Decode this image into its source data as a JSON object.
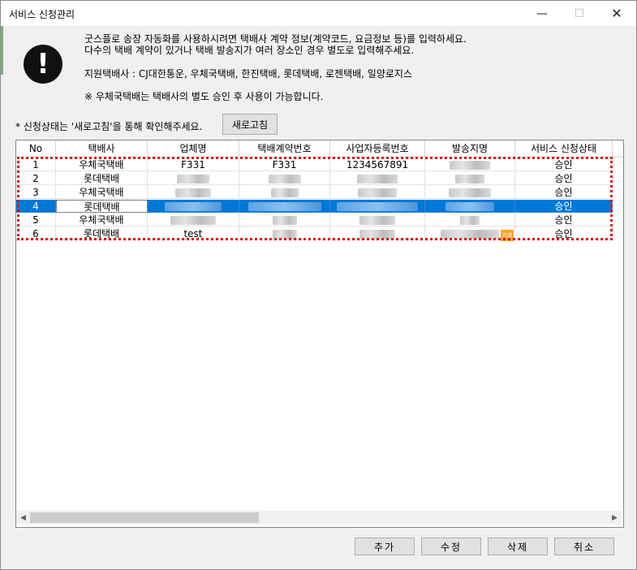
{
  "window": {
    "title": "서비스 신청관리",
    "minimize": "—",
    "maximize": "☐",
    "close": "✕"
  },
  "info": {
    "icon": "exclamation-icon",
    "icon_glyph": "!",
    "line1": "굿스플로 송장 자동화를 사용하시려면 택배사 계약 정보(계약코드, 요금정보 등)를 입력하세요.",
    "line2": "다수의 택배 계약이 있거나 택배 발송지가 여러 장소인 경우 별도로 입력해주세요.",
    "line3": "지원택배사 : CJ대한통운, 우체국택배, 한진택배, 롯데택배, 로젠택배, 일양로지스",
    "line4": "※ 우체국택배는 택배사의 별도 승인 후 사용이 가능합니다."
  },
  "status_hint": "* 신청상태는 '새로고침'을 통해 확인해주세요.",
  "refresh_label": "새로고침",
  "table": {
    "columns": [
      "No",
      "택배사",
      "업체명",
      "택배계약번호",
      "사업자등록번호",
      "발송지명",
      "서비스 신청상태"
    ],
    "rows": [
      {
        "no": "1",
        "carrier": "우체국택배",
        "company": "F331",
        "contract": "F331",
        "bizno": "1234567891",
        "sender": "",
        "status": "승인"
      },
      {
        "no": "2",
        "carrier": "롯데택배",
        "company": "",
        "contract": "",
        "bizno": "",
        "sender": "",
        "status": "승인"
      },
      {
        "no": "3",
        "carrier": "우체국택배",
        "company": "",
        "contract": "",
        "bizno": "",
        "sender": "",
        "status": "승인"
      },
      {
        "no": "4",
        "carrier": "롯데택배",
        "company": "",
        "contract": "",
        "bizno": "",
        "sender": "",
        "status": "승인"
      },
      {
        "no": "5",
        "carrier": "우체국택배",
        "company": "",
        "contract": "",
        "bizno": "",
        "sender": "",
        "status": "승인"
      },
      {
        "no": "6",
        "carrier": "롯데택배",
        "company": "test",
        "contract": "",
        "bizno": "",
        "sender": "",
        "status": "승인"
      }
    ],
    "selected_row": "4",
    "badge": "기본"
  },
  "buttons": {
    "add": "추가",
    "edit": "수정",
    "delete": "삭제",
    "cancel": "취소"
  }
}
